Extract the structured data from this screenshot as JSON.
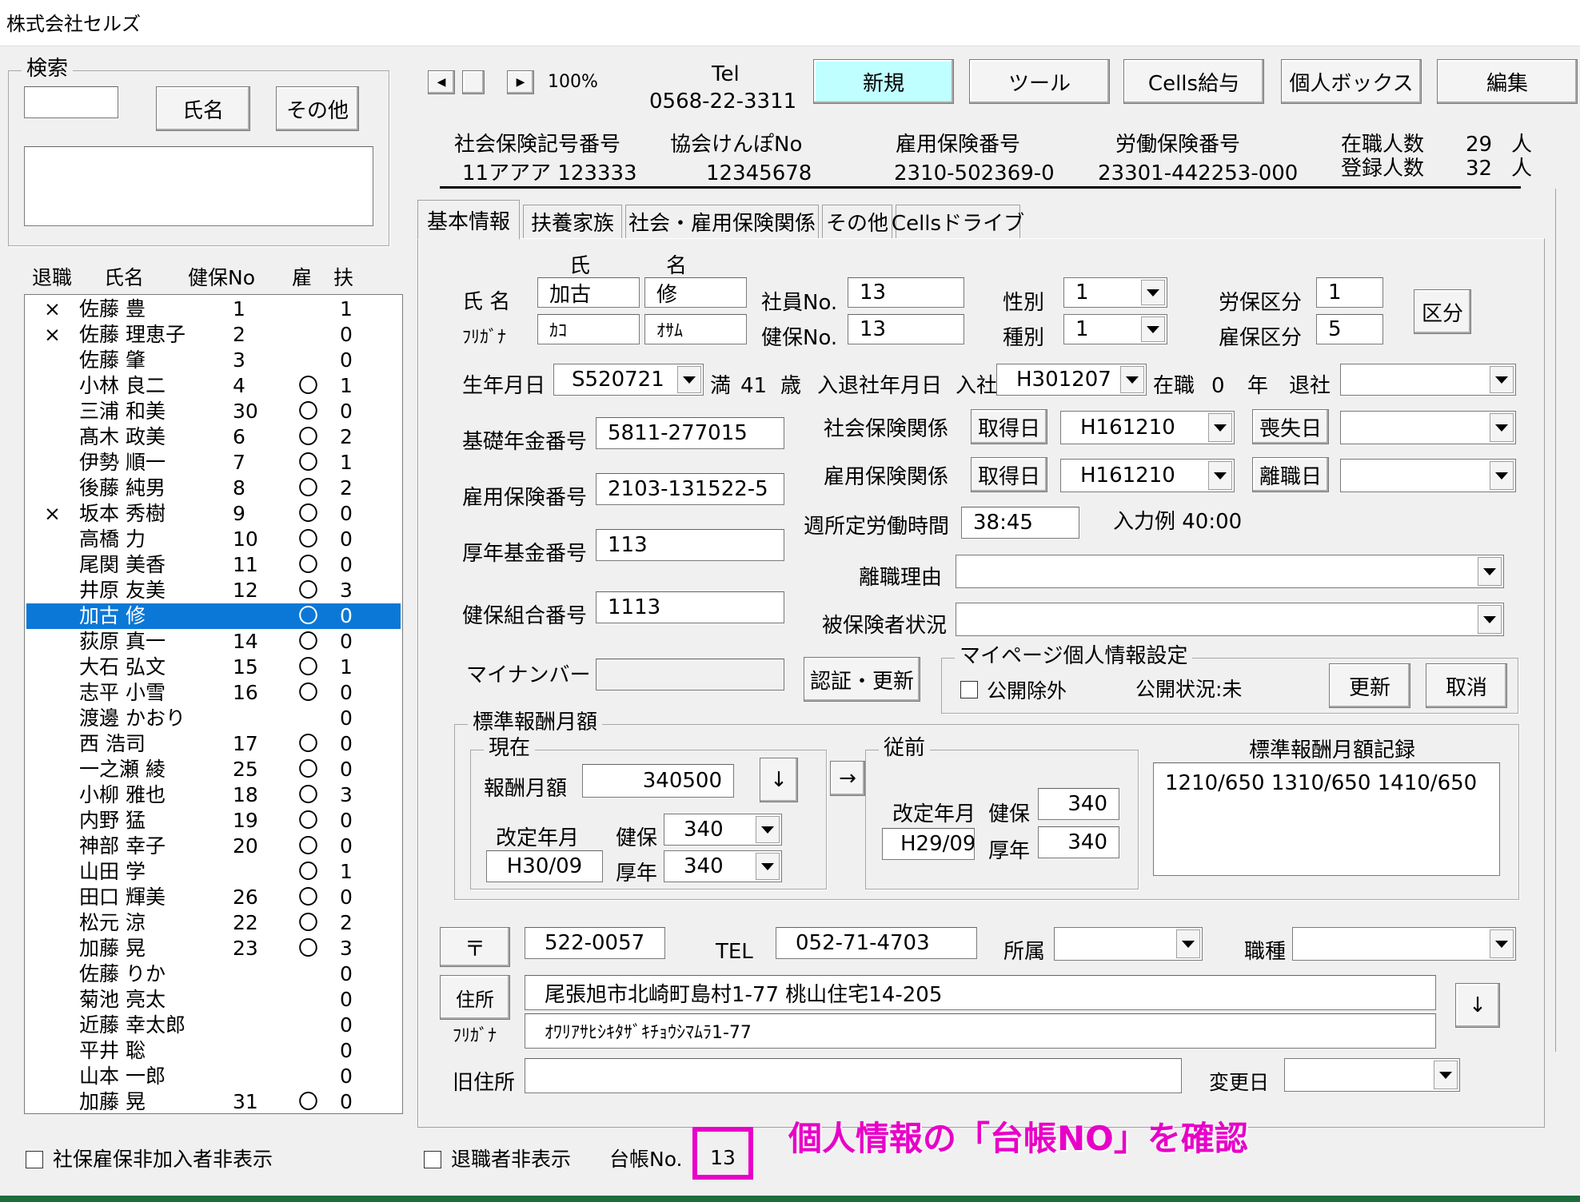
{
  "window": {
    "title": "株式会社セルズ"
  },
  "search": {
    "caption": "検索",
    "name_button": "氏名",
    "other_button": "その他"
  },
  "list": {
    "headers": {
      "retired": "退職",
      "name": "氏名",
      "kenpo": "健保No",
      "koyo": "雇",
      "fuyo": "扶"
    },
    "selected_index": 12,
    "rows": [
      {
        "r": "×",
        "n": "佐藤 豊",
        "k": "1",
        "y": "",
        "f": "1"
      },
      {
        "r": "×",
        "n": "佐藤 理恵子",
        "k": "2",
        "y": "",
        "f": "0"
      },
      {
        "r": "",
        "n": "佐藤 肇",
        "k": "3",
        "y": "",
        "f": "0"
      },
      {
        "r": "",
        "n": "小林 良二",
        "k": "4",
        "y": "〇",
        "f": "1"
      },
      {
        "r": "",
        "n": "三浦 和美",
        "k": "30",
        "y": "〇",
        "f": "0"
      },
      {
        "r": "",
        "n": "髙木 政美",
        "k": "6",
        "y": "〇",
        "f": "2"
      },
      {
        "r": "",
        "n": "伊勢 順一",
        "k": "7",
        "y": "〇",
        "f": "1"
      },
      {
        "r": "",
        "n": "後藤 純男",
        "k": "8",
        "y": "〇",
        "f": "2"
      },
      {
        "r": "×",
        "n": "坂本 秀樹",
        "k": "9",
        "y": "〇",
        "f": "0"
      },
      {
        "r": "",
        "n": "高橋 力",
        "k": "10",
        "y": "〇",
        "f": "0"
      },
      {
        "r": "",
        "n": "尾関 美香",
        "k": "11",
        "y": "〇",
        "f": "0"
      },
      {
        "r": "",
        "n": "井原 友美",
        "k": "12",
        "y": "〇",
        "f": "3"
      },
      {
        "r": "",
        "n": "加古 修",
        "k": "",
        "y": "〇",
        "f": "0"
      },
      {
        "r": "",
        "n": "荻原 真一",
        "k": "14",
        "y": "〇",
        "f": "0"
      },
      {
        "r": "",
        "n": "大石 弘文",
        "k": "15",
        "y": "〇",
        "f": "1"
      },
      {
        "r": "",
        "n": "志平 小雪",
        "k": "16",
        "y": "〇",
        "f": "0"
      },
      {
        "r": "",
        "n": "渡邊 かおり",
        "k": "",
        "y": "",
        "f": "0"
      },
      {
        "r": "",
        "n": "西 浩司",
        "k": "17",
        "y": "〇",
        "f": "0"
      },
      {
        "r": "",
        "n": "一之瀬 綾",
        "k": "25",
        "y": "〇",
        "f": "0"
      },
      {
        "r": "",
        "n": "小柳 雅也",
        "k": "18",
        "y": "〇",
        "f": "3"
      },
      {
        "r": "",
        "n": "内野 猛",
        "k": "19",
        "y": "〇",
        "f": "0"
      },
      {
        "r": "",
        "n": "神部 幸子",
        "k": "20",
        "y": "〇",
        "f": "0"
      },
      {
        "r": "",
        "n": "山田 学",
        "k": "",
        "y": "〇",
        "f": "1"
      },
      {
        "r": "",
        "n": "田口 輝美",
        "k": "26",
        "y": "〇",
        "f": "0"
      },
      {
        "r": "",
        "n": "松元 涼",
        "k": "22",
        "y": "〇",
        "f": "2"
      },
      {
        "r": "",
        "n": "加藤 晃",
        "k": "23",
        "y": "〇",
        "f": "3"
      },
      {
        "r": "",
        "n": "佐藤 りか",
        "k": "",
        "y": "",
        "f": "0"
      },
      {
        "r": "",
        "n": "菊池 亮太",
        "k": "",
        "y": "",
        "f": "0"
      },
      {
        "r": "",
        "n": "近藤 幸太郎",
        "k": "",
        "y": "",
        "f": "0"
      },
      {
        "r": "",
        "n": "平井 聡",
        "k": "",
        "y": "",
        "f": "0"
      },
      {
        "r": "",
        "n": "山本 一郎",
        "k": "",
        "y": "",
        "f": "0"
      },
      {
        "r": "",
        "n": "加藤 晃",
        "k": "31",
        "y": "〇",
        "f": "0"
      }
    ]
  },
  "footer": {
    "hide_uninsured": "社保雇保非加入者非表示",
    "hide_retired": "退職者非表示",
    "daicho_label": "台帳No.",
    "daicho_value": "13",
    "annotation": "個人情報の「台帳NO」を確認"
  },
  "header": {
    "zoom": "100%",
    "tel_label": "Tel",
    "tel": "0568-22-3311",
    "buttons": {
      "new": "新規",
      "tool": "ツール",
      "cells_salary": "Cells給与",
      "personal_box": "個人ボックス",
      "edit": "編集"
    },
    "info": {
      "shaho_label": "社会保険記号番号",
      "shaho": "11アアア 123333",
      "kyokai_label": "協会けんぽNo",
      "kyokai": "12345678",
      "koyo_label": "雇用保険番号",
      "koyo": "2310-502369-0",
      "rodo_label": "労働保険番号",
      "rodo": "23301-442253-000",
      "zaishoku_label": "在職人数",
      "zaishoku": "29",
      "zaishoku_unit": "人",
      "toroku_label": "登録人数",
      "toroku": "32",
      "toroku_unit": "人"
    }
  },
  "tabs": [
    "基本情報",
    "扶養家族",
    "社会・雇用保険関係",
    "その他",
    "Cellsドライブ"
  ],
  "form": {
    "sei_head": "氏",
    "mei_head": "名",
    "name_label": "氏 名",
    "kana_label": "ﾌﾘｶﾞﾅ",
    "sei": "加古",
    "mei": "修",
    "sei_kana": "ｶｺ",
    "mei_kana": "ｵｻﾑ",
    "shain_label": "社員No.",
    "shain": "13",
    "kenpo_label": "健保No.",
    "kenpo": "13",
    "seibetsu_label": "性別",
    "seibetsu": "1",
    "shubetsu_label": "種別",
    "shubetsu": "1",
    "roho_label": "労保区分",
    "roho": "1",
    "koho_label": "雇保区分",
    "koho": "5",
    "kubun_button": "区分",
    "birth_label": "生年月日",
    "birth": "S520721",
    "age_prefix": "満",
    "age": "41",
    "age_unit": "歳",
    "nyutai_label": "入退社年月日",
    "nyusha_label": "入社",
    "nyusha": "H301207",
    "zaishoku_label": "在職",
    "zaishoku_years": "0",
    "year_unit": "年",
    "taisha_label": "退社",
    "taisha": "",
    "kiso_label": "基礎年金番号",
    "kiso": "5811-277015",
    "koyo_no_label": "雇用保険番号",
    "koyo_no": "2103-131522-5",
    "kosei_label": "厚年基金番号",
    "kosei": "113",
    "kenpo_kumiai_label": "健保組合番号",
    "kenpo_kumiai": "1113",
    "mynumber_label": "マイナンバー",
    "mynumber": "",
    "ninsho_button": "認証・更新",
    "shaho_kankei_label": "社会保険関係",
    "shutoku_button": "取得日",
    "shaho_shutoku": "H161210",
    "soshitsu_button": "喪失日",
    "shaho_soshitsu": "",
    "koyo_kankei_label": "雇用保険関係",
    "koyo_shutoku_button": "取得日",
    "koyo_shutoku": "H161210",
    "rishoku_button": "離職日",
    "koyo_rishoku": "",
    "shotei_label": "週所定労働時間",
    "shotei": "38:45",
    "nyuryokurei": "入力例  40:00",
    "rishoku_riyu_label": "離職理由",
    "rishoku_riyu": "",
    "hihoken_label": "被保険者状況",
    "hihoken": ""
  },
  "mypage": {
    "caption": "マイページ個人情報設定",
    "exclude_label": "公開除外",
    "status": "公開状況:未",
    "update_button": "更新",
    "cancel_button": "取消"
  },
  "hyojun": {
    "caption": "標準報酬月額",
    "current_caption": "現在",
    "hoshu_label": "報酬月額",
    "hoshu": "340500",
    "down_arrow": "↓",
    "kaitei_label": "改定年月",
    "kaitei": "H30/09",
    "kenpo_label": "健保",
    "kenpo": "340",
    "kosei_label": "厚年",
    "kosei": "340",
    "right_arrow": "→",
    "prev_caption": "従前",
    "prev_kaitei_label": "改定年月",
    "prev_kaitei": "H29/09",
    "prev_kenpo_label": "健保",
    "prev_kenpo": "340",
    "prev_kosei_label": "厚年",
    "prev_kosei": "340",
    "record_label": "標準報酬月額記録",
    "record": "1210/650 1310/650 1410/650"
  },
  "address": {
    "zip_button": "〒",
    "zip": "522-0057",
    "tel_label": "TEL",
    "tel": "052-71-4703",
    "shozoku_label": "所属",
    "shozoku": "",
    "shokushu_label": "職種",
    "shokushu": "",
    "jusho_button": "住所",
    "jusho": "尾張旭市北崎町島村1-77  桃山住宅14-205",
    "kana_label": "ﾌﾘｶﾞﾅ",
    "jusho_kana": "ｵﾜﾘｱｻﾋｼｷﾀｻﾞｷﾁｮｳｼﾏﾑﾗ1-77",
    "down_arrow": "↓",
    "old_label": "旧住所",
    "old": "",
    "henko_label": "変更日",
    "henko": ""
  },
  "colors": {
    "accent": "#c0ffff",
    "select": "#0b78d7",
    "highlight": "#e800c8",
    "statusbar": "#1e6b3c"
  }
}
